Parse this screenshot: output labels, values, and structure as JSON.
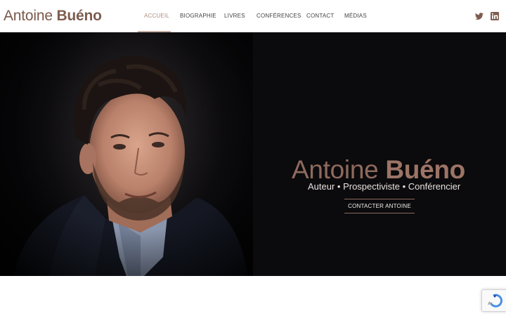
{
  "header": {
    "logo_first": "Antoine",
    "logo_last": "Buéno",
    "nav": [
      {
        "label": "ACCUEIL",
        "active": true
      },
      {
        "label": "BIOGRAPHIE",
        "active": false
      },
      {
        "label": "LIVRES",
        "active": false
      },
      {
        "label": "CONFÉRENCES",
        "active": false
      },
      {
        "label": "CONTACT",
        "active": false
      },
      {
        "label": "MÉDIAS",
        "active": false
      }
    ],
    "social": [
      {
        "icon": "twitter-icon"
      },
      {
        "icon": "linkedin-icon"
      }
    ]
  },
  "hero": {
    "name_first": "Antoine",
    "name_last": "Buéno",
    "tagline": "Auteur • Prospectiviste • Conférencier",
    "cta_label": "CONTACTER ANTOINE"
  },
  "colors": {
    "accent": "#9c7466",
    "nav_active": "#b08e7e",
    "hero_background": "#0b0a0c"
  }
}
